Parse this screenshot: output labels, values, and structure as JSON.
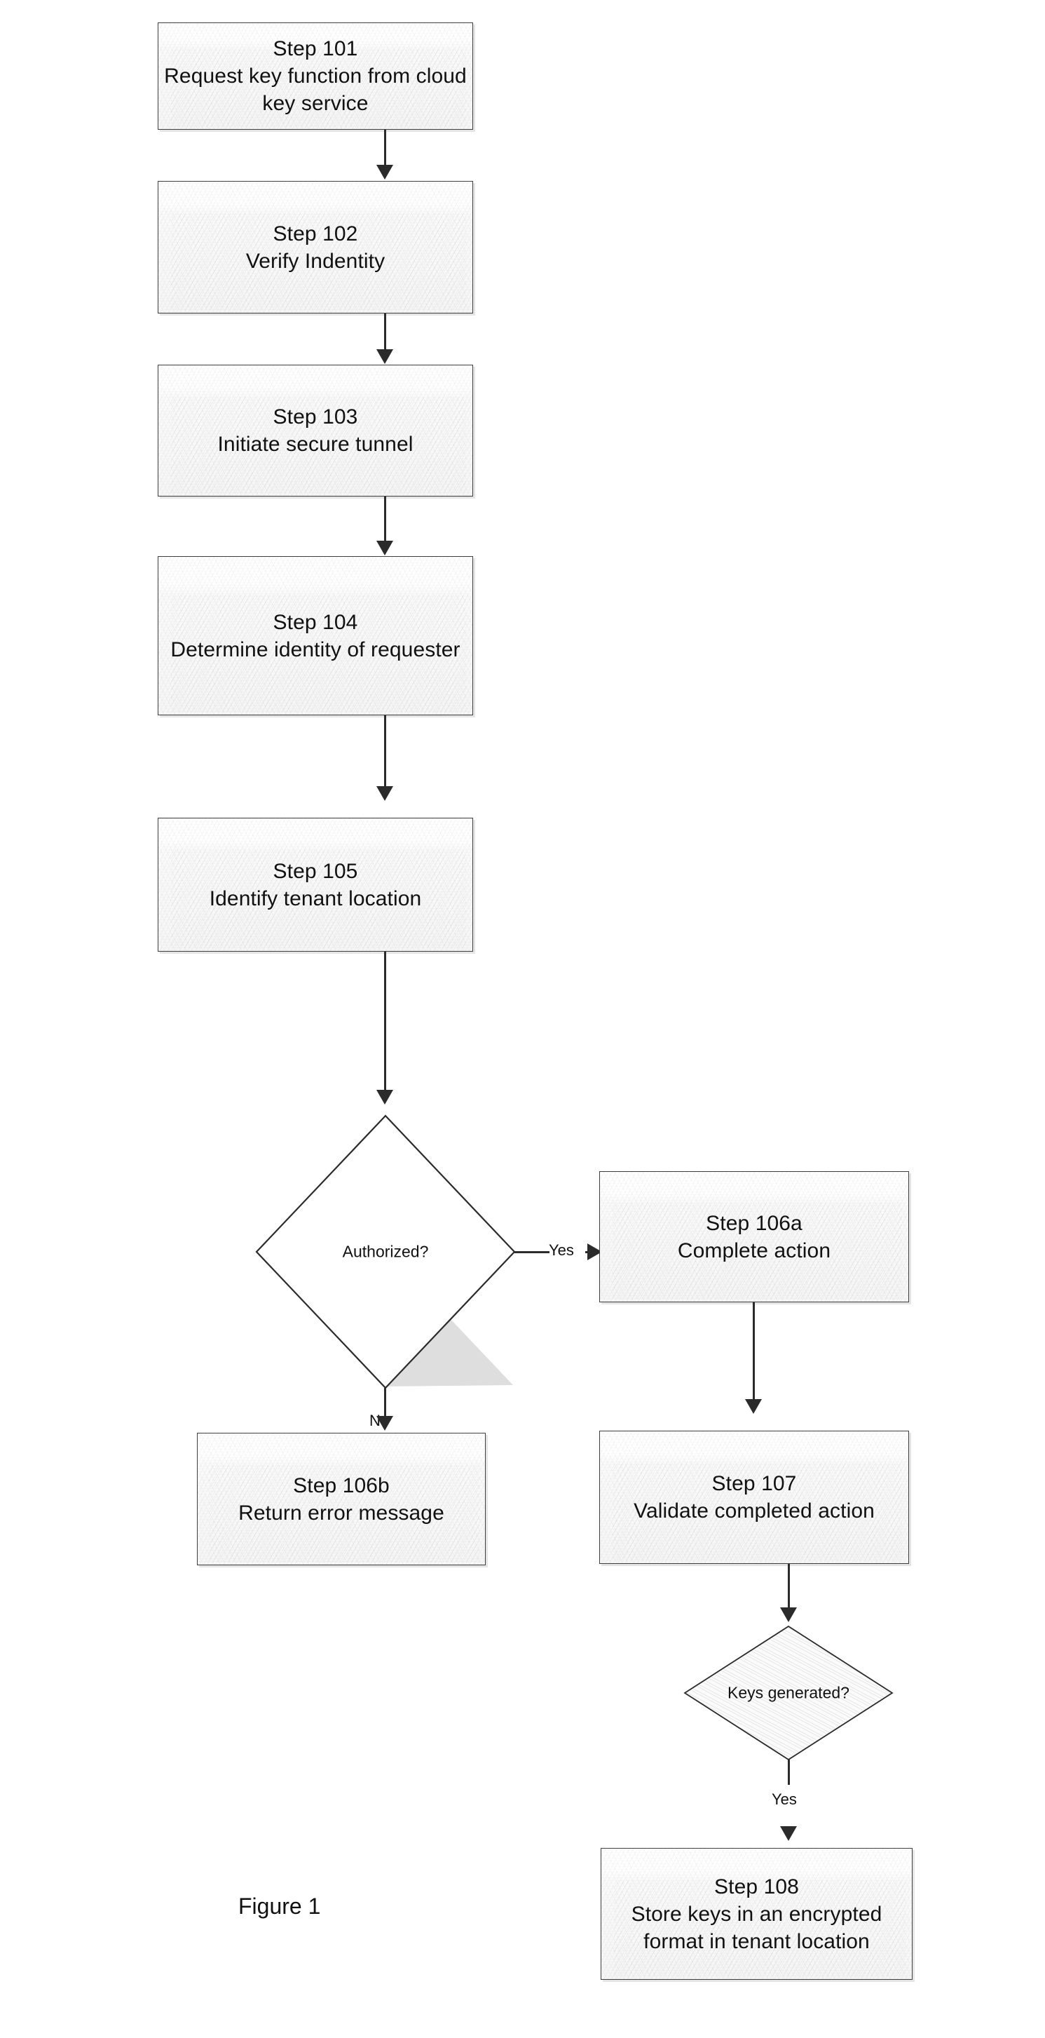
{
  "figure": {
    "caption": "Figure 1"
  },
  "nodes": [
    {
      "id": "step-101",
      "shape": "process",
      "lines": [
        "Step 101",
        "Request key function from cloud",
        "key service"
      ]
    },
    {
      "id": "step-102",
      "shape": "process",
      "lines": [
        "Step 102",
        "Verify Indentity"
      ]
    },
    {
      "id": "step-103",
      "shape": "process",
      "lines": [
        "Step 103",
        "Initiate secure tunnel"
      ]
    },
    {
      "id": "step-104",
      "shape": "process",
      "lines": [
        "Step 104",
        "Determine identity of requester"
      ]
    },
    {
      "id": "step-105",
      "shape": "process",
      "lines": [
        "Step 105",
        "Identify tenant location"
      ]
    },
    {
      "id": "decision-authorized",
      "shape": "decision",
      "lines": [
        "Authorized?"
      ]
    },
    {
      "id": "step-106a",
      "shape": "process",
      "lines": [
        "Step 106a",
        "Complete action"
      ]
    },
    {
      "id": "step-106b",
      "shape": "process",
      "lines": [
        "Step 106b",
        "Return error message"
      ]
    },
    {
      "id": "step-107",
      "shape": "process",
      "lines": [
        "Step 107",
        "Validate completed action"
      ]
    },
    {
      "id": "decision-keys-generated",
      "shape": "decision",
      "lines": [
        "Keys generated?"
      ]
    },
    {
      "id": "step-108",
      "shape": "process",
      "lines": [
        "Step 108",
        "Store keys in an encrypted",
        "format in tenant location"
      ]
    }
  ],
  "edge_labels": {
    "authorized_yes": "Yes",
    "authorized_no": "No",
    "keys_generated_yes": "Yes"
  },
  "colors": {
    "stroke": "#2b2b2b",
    "box_border": "#3f3f3f",
    "box_fill": "#fcfcfc",
    "text": "#111111",
    "background": "#ffffff"
  }
}
